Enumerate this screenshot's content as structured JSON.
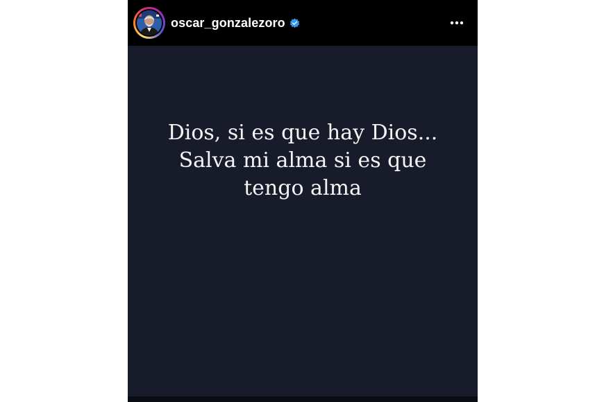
{
  "story": {
    "username": "oscar_gonzalezoro",
    "verified": true,
    "more_icon": "more-horizontal-icon",
    "text_lines": [
      "Dios, si es que hay Dios...",
      "Salva mi alma si es que",
      "tengo alma"
    ]
  },
  "colors": {
    "header_background": "#000000",
    "story_background": "#171b2a",
    "text": "#f4f4f4",
    "verified_badge": "#3797f0"
  }
}
